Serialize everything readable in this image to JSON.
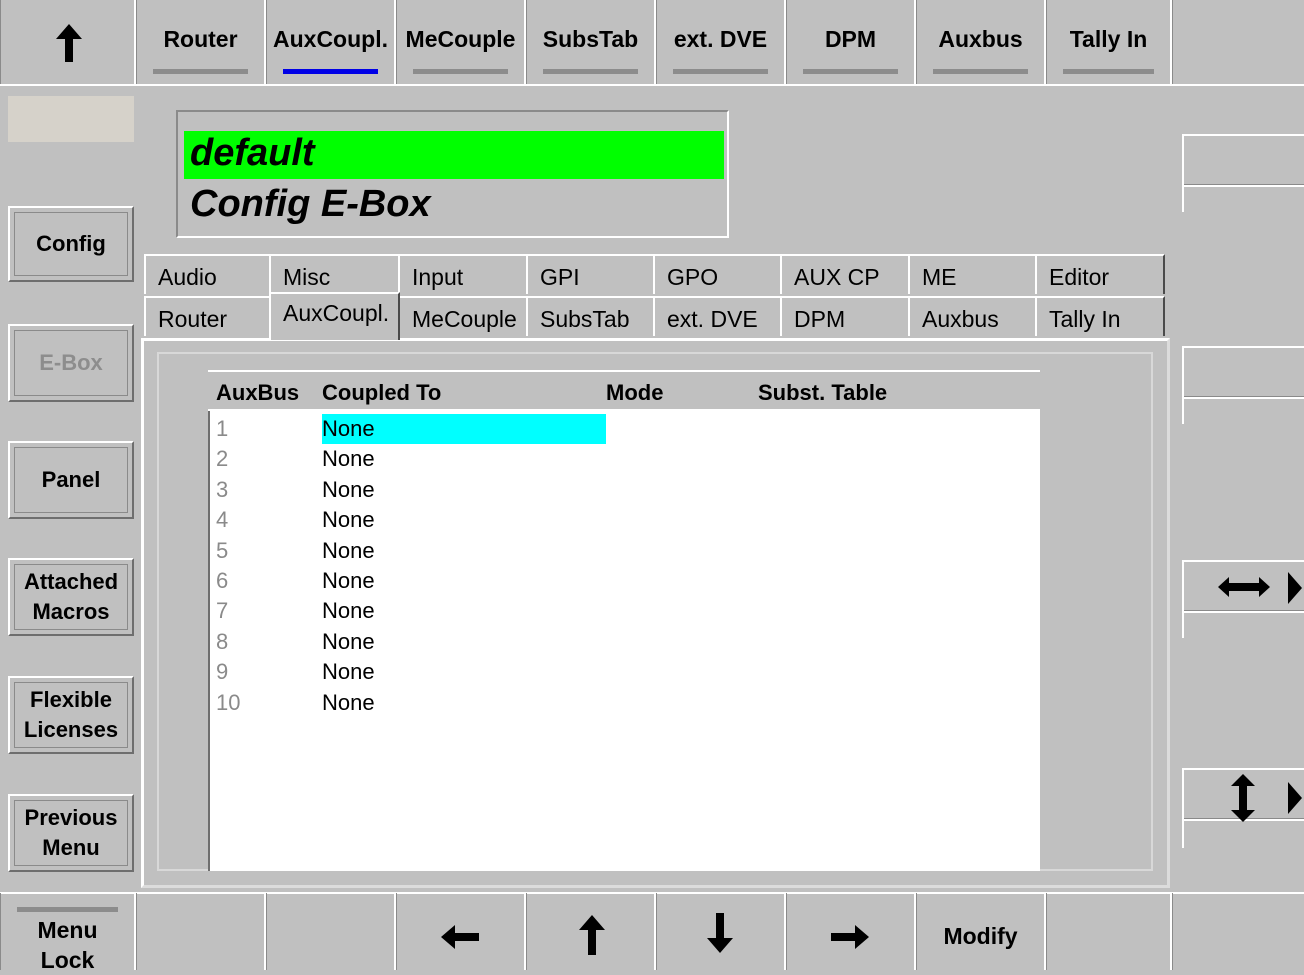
{
  "top_nav": {
    "up_icon": "up-arrow-icon",
    "items": [
      {
        "label": "Router",
        "active": false
      },
      {
        "label": "AuxCoupl.",
        "active": true
      },
      {
        "label": "MeCouple",
        "active": false
      },
      {
        "label": "SubsTab",
        "active": false
      },
      {
        "label": "ext. DVE",
        "active": false
      },
      {
        "label": "DPM",
        "active": false
      },
      {
        "label": "Auxbus",
        "active": false
      },
      {
        "label": "Tally In",
        "active": false
      }
    ],
    "active_color": "#0000e6"
  },
  "sidebar": {
    "items": [
      {
        "label": "Config",
        "enabled": true
      },
      {
        "label": "E-Box",
        "enabled": false
      },
      {
        "label": "Panel",
        "enabled": true
      },
      {
        "label": "Attached\nMacros",
        "enabled": true
      },
      {
        "label": "Flexible\nLicenses",
        "enabled": true
      },
      {
        "label": "Previous\nMenu",
        "enabled": true
      }
    ]
  },
  "display": {
    "line1": "default",
    "line2": "Config E-Box",
    "highlight_color": "#00ff00"
  },
  "tabs": {
    "row1": [
      "Audio",
      "Misc",
      "Input",
      "GPI",
      "GPO",
      "AUX CP",
      "ME",
      "Editor"
    ],
    "row2": [
      "Router",
      "AuxCoupl.",
      "MeCouple",
      "SubsTab",
      "ext. DVE",
      "DPM",
      "Auxbus",
      "Tally In"
    ],
    "active": "AuxCoupl."
  },
  "table": {
    "columns": [
      "AuxBus",
      "Coupled To",
      "Mode",
      "Subst. Table"
    ],
    "rows": [
      {
        "aux": "1",
        "coupled": "None"
      },
      {
        "aux": "2",
        "coupled": "None"
      },
      {
        "aux": "3",
        "coupled": "None"
      },
      {
        "aux": "4",
        "coupled": "None"
      },
      {
        "aux": "5",
        "coupled": "None"
      },
      {
        "aux": "6",
        "coupled": "None"
      },
      {
        "aux": "7",
        "coupled": "None"
      },
      {
        "aux": "8",
        "coupled": "None"
      },
      {
        "aux": "9",
        "coupled": "None"
      },
      {
        "aux": "10",
        "coupled": "None"
      }
    ],
    "selected_row": 0,
    "selection_color": "#00ffff"
  },
  "right_controls": {
    "horizontal_scroll_icon": "horizontal-resize-icon",
    "vertical_scroll_icon": "vertical-resize-icon"
  },
  "bottom_bar": {
    "menu_lock": "Menu\nLock",
    "left_icon": "left-arrow-icon",
    "up_icon": "up-arrow-icon",
    "down_icon": "down-arrow-icon",
    "right_icon": "right-arrow-icon",
    "modify": "Modify"
  }
}
